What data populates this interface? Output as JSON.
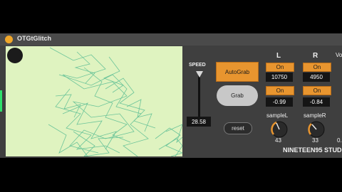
{
  "window": {
    "title": "OTGtGlitch"
  },
  "speed": {
    "label": "SPEED",
    "value": "28.58"
  },
  "buttons": {
    "autograb": "AutoGrab",
    "grab": "Grab",
    "reset": "reset"
  },
  "channels": {
    "left": {
      "header": "L",
      "toggle1": "On",
      "value1": "10750",
      "toggle2": "On",
      "value2": "-0.99",
      "knob_label": "sampleL",
      "knob_value": "43"
    },
    "right": {
      "header": "R",
      "toggle1": "On",
      "value1": "4950",
      "toggle2": "On",
      "value2": "-0.84",
      "knob_label": "sampleR",
      "knob_value": "33"
    }
  },
  "edge": {
    "label_right": "Vo",
    "value_right": "0."
  },
  "footer": {
    "brand": "NINETEEN95 STUD"
  },
  "colors": {
    "accent": "#e8952f",
    "canvas_bg": "#dff3c0",
    "line": "#5fbf95",
    "panel": "#3f3f3f"
  }
}
